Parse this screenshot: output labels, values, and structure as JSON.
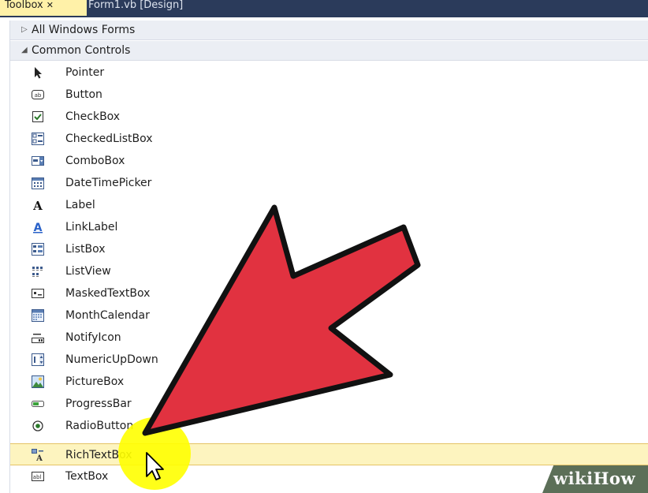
{
  "tabs": [
    {
      "label": "Toolbox",
      "close": "✕"
    },
    {
      "label": "Form1.vb [Design]"
    }
  ],
  "groups": [
    {
      "label": "All Windows Forms",
      "expanded": false
    },
    {
      "label": "Common Controls",
      "expanded": true
    }
  ],
  "items": [
    {
      "label": "Pointer",
      "icon": "pointer-icon"
    },
    {
      "label": "Button",
      "icon": "button-icon"
    },
    {
      "label": "CheckBox",
      "icon": "checkbox-icon"
    },
    {
      "label": "CheckedListBox",
      "icon": "checkedlistbox-icon"
    },
    {
      "label": "ComboBox",
      "icon": "combobox-icon"
    },
    {
      "label": "DateTimePicker",
      "icon": "datetimepicker-icon"
    },
    {
      "label": "Label",
      "icon": "label-icon"
    },
    {
      "label": "LinkLabel",
      "icon": "linklabel-icon"
    },
    {
      "label": "ListBox",
      "icon": "listbox-icon"
    },
    {
      "label": "ListView",
      "icon": "listview-icon"
    },
    {
      "label": "MaskedTextBox",
      "icon": "maskedtextbox-icon"
    },
    {
      "label": "MonthCalendar",
      "icon": "monthcalendar-icon"
    },
    {
      "label": "NotifyIcon",
      "icon": "notifyicon-icon"
    },
    {
      "label": "NumericUpDown",
      "icon": "numericupdown-icon"
    },
    {
      "label": "PictureBox",
      "icon": "picturebox-icon"
    },
    {
      "label": "ProgressBar",
      "icon": "progressbar-icon"
    },
    {
      "label": "RadioButton",
      "icon": "radiobutton-icon"
    },
    {
      "label": "RichTextBox",
      "icon": "richtextbox-icon",
      "selected": true
    },
    {
      "label": "TextBox",
      "icon": "textbox-icon"
    }
  ],
  "watermark": {
    "wiki": "wiki",
    "how": "How"
  },
  "colors": {
    "tabbar": "#2b3b5b",
    "active_tab": "#fff1a8",
    "selected_row": "#fdf4bf",
    "arrow_fill": "#e13240",
    "highlight": "#ffff00"
  }
}
